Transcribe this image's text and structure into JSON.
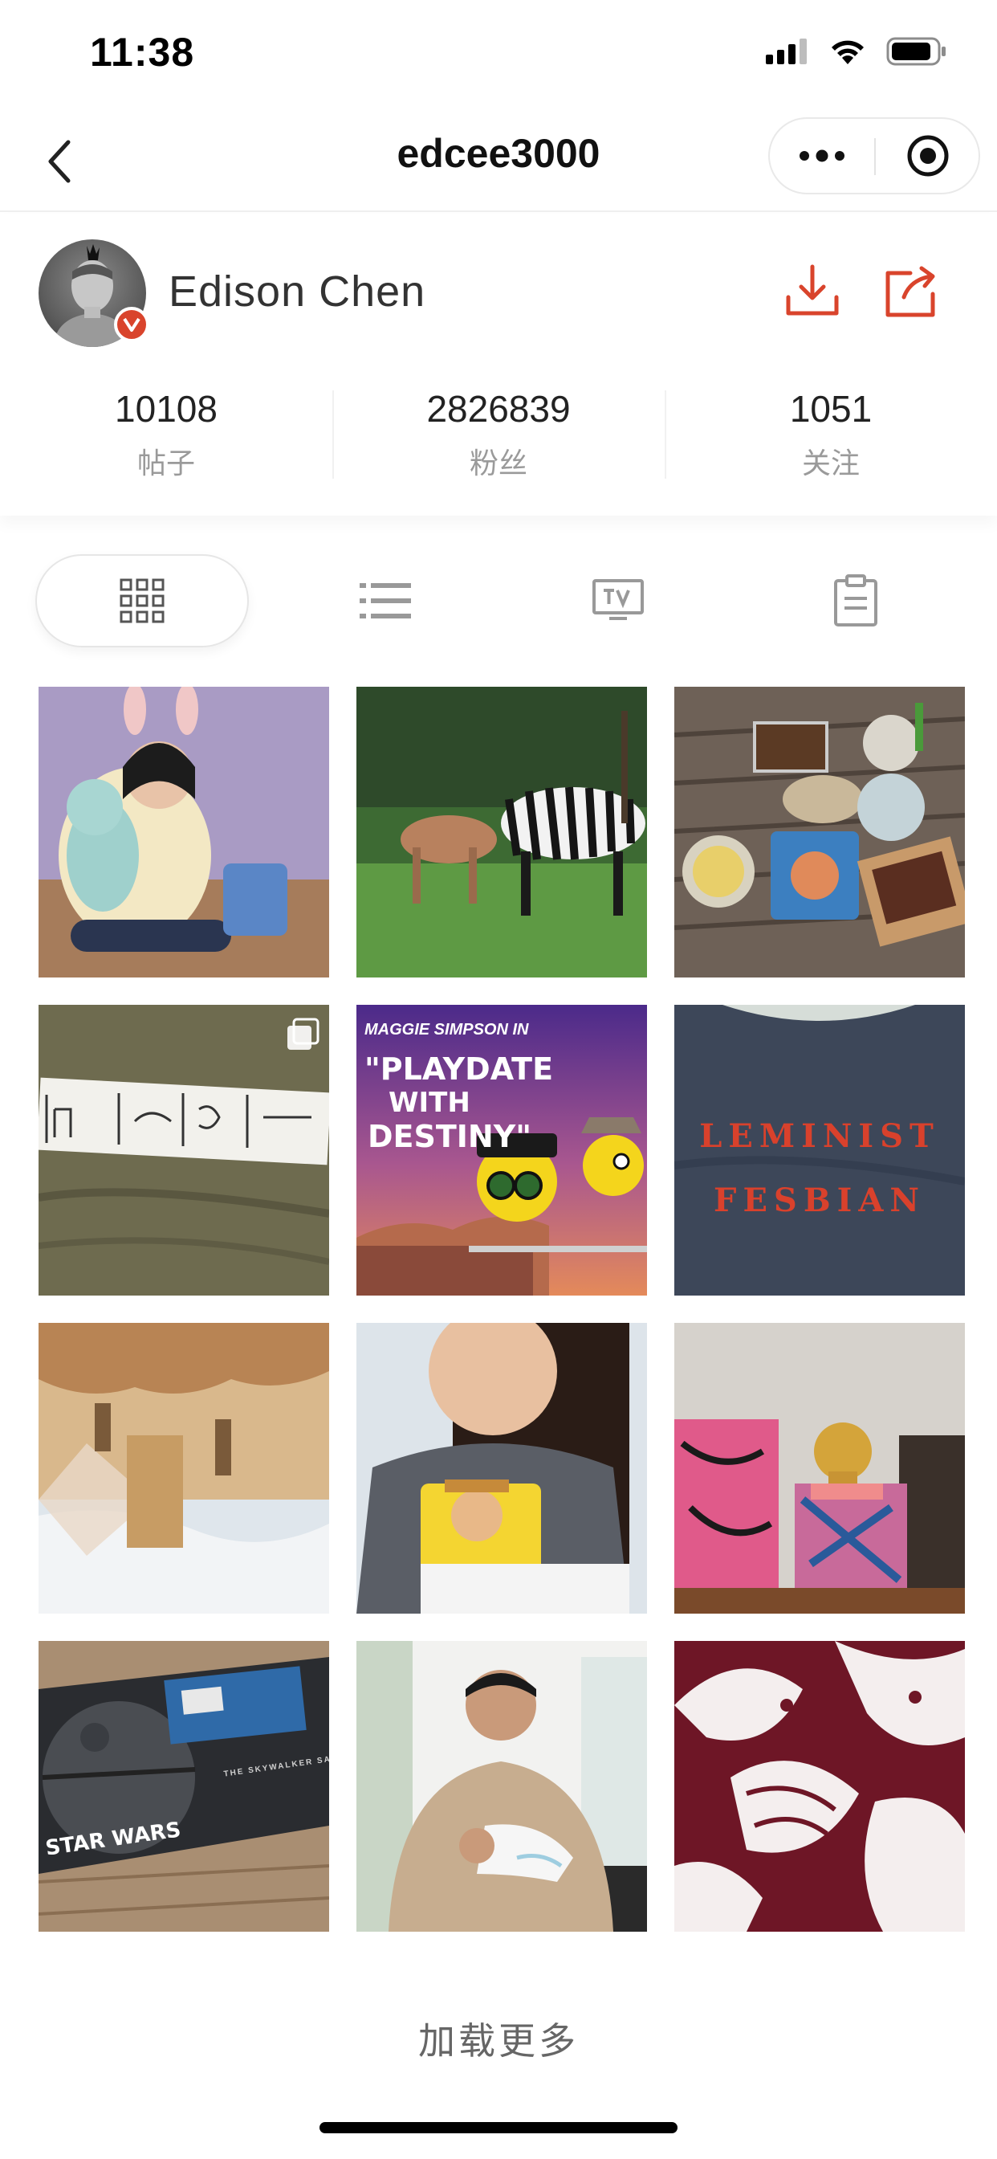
{
  "status_bar": {
    "time": "11:38"
  },
  "nav": {
    "title": "edcee3000",
    "icons": {
      "back": "chevron-left-icon",
      "more": "more-dots-icon",
      "target": "target-icon"
    }
  },
  "profile": {
    "name": "Edison Chen",
    "verified_badge": "verified-badge-icon",
    "actions": {
      "download": "download-icon",
      "share": "share-icon"
    },
    "accent_color": "#d9442c",
    "stats": [
      {
        "value": "10108",
        "label": "帖子"
      },
      {
        "value": "2826839",
        "label": "粉丝"
      },
      {
        "value": "1051",
        "label": "关注"
      }
    ]
  },
  "tabs": [
    {
      "icon": "grid-icon",
      "active": true
    },
    {
      "icon": "list-icon",
      "active": false
    },
    {
      "icon": "tv-icon",
      "active": false
    },
    {
      "icon": "clipboard-icon",
      "active": false
    }
  ],
  "posts": {
    "tile_1": {
      "subject": "child-with-bunny-plush"
    },
    "tile_2": {
      "subject": "zebras-on-grass"
    },
    "tile_3": {
      "subject": "food-on-wooden-table"
    },
    "tile_4": {
      "subject": "olive-tshirt-with-tape-drawing",
      "multi": true
    },
    "tile_5": {
      "line1": "MAGGIE SIMPSON IN",
      "line2": "\"PLAYDATE",
      "line3": "WITH",
      "line4": "DESTINY\""
    },
    "tile_6": {
      "line1": "LEMINIST",
      "line2": "FESBIAN"
    },
    "tile_7": {
      "subject": "upside-down-photo"
    },
    "tile_8": {
      "subject": "child-with-toy-story-shirt"
    },
    "tile_9": {
      "subject": "paintings-and-gold-skull"
    },
    "tile_10": {
      "line1": "STAR WARS",
      "line2": "THE SKYWALKER SAGA"
    },
    "tile_11": {
      "subject": "man-holding-sneaker"
    },
    "tile_12": {
      "subject": "maroon-print-fabric"
    }
  },
  "load_more": "加载更多"
}
